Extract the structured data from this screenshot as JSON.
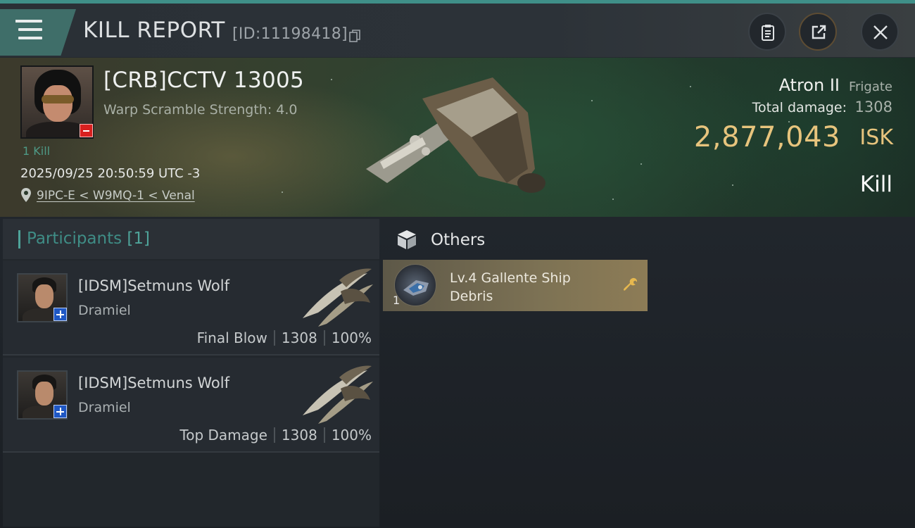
{
  "header": {
    "title": "KILL REPORT",
    "report_id": "[ID:11198418]"
  },
  "victim": {
    "name": "[CRB]CCTV 13005",
    "warp_scramble": "Warp Scramble Strength: 4.0",
    "kill_count": "1 Kill",
    "time": "2025/09/25 20:50:59 UTC -3",
    "location": "9IPC-E < W9MQ-1 < Venal",
    "ship_name": "Atron II",
    "ship_class": "Frigate",
    "total_damage_label": "Total damage:",
    "total_damage": "1308",
    "isk_value": "2,877,043",
    "isk_unit": "ISK",
    "result": "Kill"
  },
  "participants": {
    "title": "Participants",
    "count": "[1]",
    "rows": [
      {
        "name": "[IDSM]Setmuns Wolf",
        "ship": "Dramiel",
        "role": "Final Blow",
        "damage": "1308",
        "percent": "100%"
      },
      {
        "name": "[IDSM]Setmuns Wolf",
        "ship": "Dramiel",
        "role": "Top Damage",
        "damage": "1308",
        "percent": "100%"
      }
    ]
  },
  "others": {
    "title": "Others",
    "items": [
      {
        "name": "Lv.4 Gallente Ship Debris",
        "quantity": "1"
      }
    ]
  },
  "colors": {
    "accent_teal": "#3f8f88",
    "isk_gold": "#e7c47d",
    "loss_red": "#d8201f",
    "ally_blue": "#1f57c3"
  },
  "icons": [
    "menu-icon",
    "copy-icon",
    "clipboard-icon",
    "share-icon",
    "close-icon",
    "location-pin-icon",
    "box-icon",
    "wrench-icon"
  ]
}
